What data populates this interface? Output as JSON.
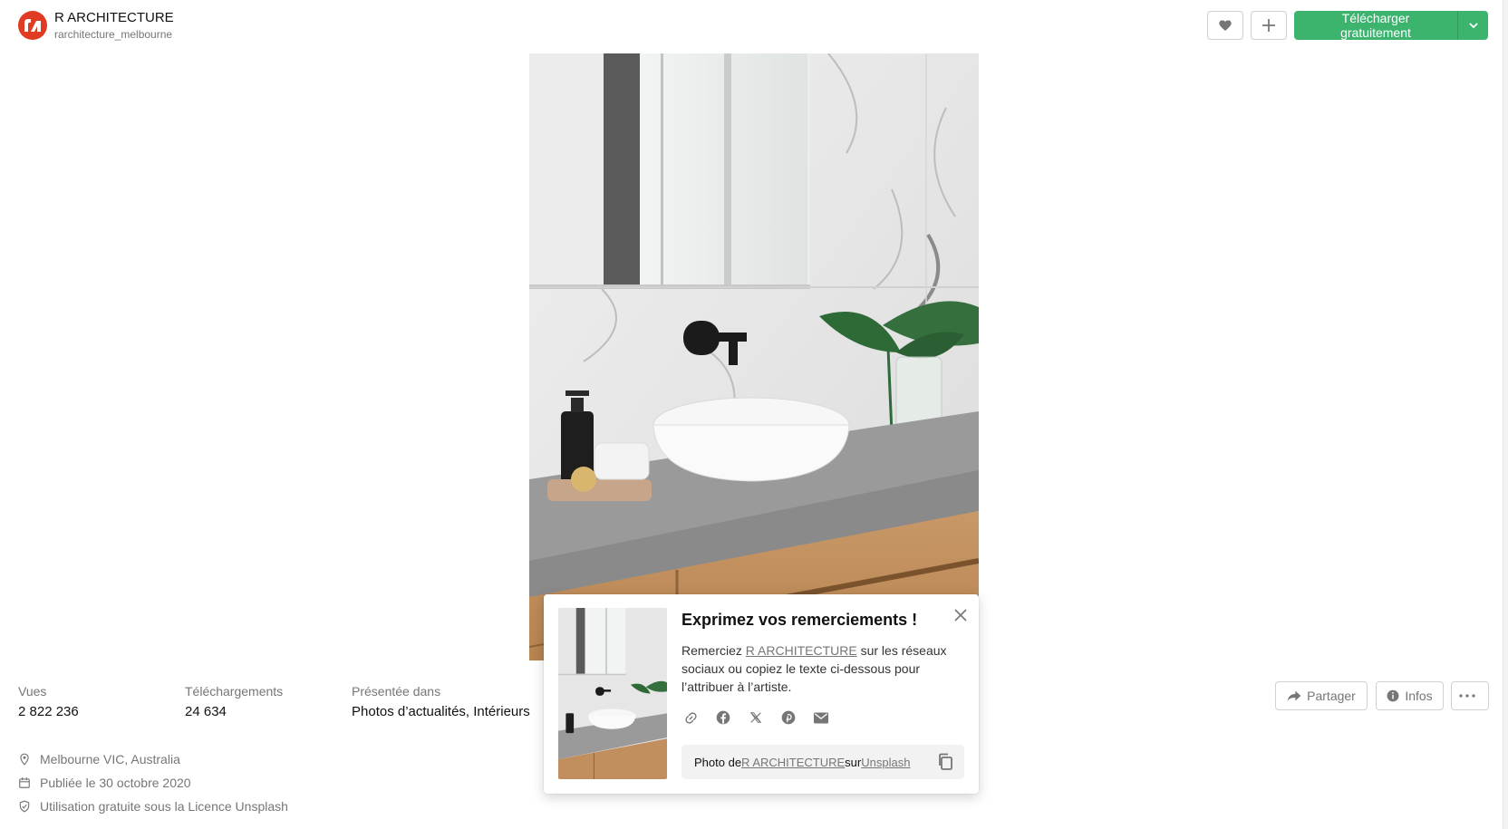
{
  "author": {
    "name": "R ARCHITECTURE",
    "handle": "rarchitecture_melbourne",
    "avatar_icon": "r-architecture-logo-icon"
  },
  "header_actions": {
    "like_icon": "heart-icon",
    "add_icon": "plus-icon",
    "download_label": "Télécharger gratuitement",
    "download_caret_icon": "chevron-down-icon",
    "accent_color": "#3cb46e"
  },
  "photo": {
    "subject_icon": "bathroom-vanity-photo"
  },
  "stats": {
    "views_label": "Vues",
    "views_value": "2 822 236",
    "downloads_label": "Téléchargements",
    "downloads_value": "24 634",
    "featured_label": "Présentée dans",
    "featured_value": "Photos d’actualités, Intérieurs"
  },
  "meta": {
    "location": "Melbourne VIC, Australia",
    "published": "Publiée le 30 octobre 2020",
    "license": "Utilisation gratuite sous la Licence Unsplash"
  },
  "actions": {
    "share_label": "Partager",
    "info_label": "Infos",
    "more_icon": "ellipsis-icon"
  },
  "popup": {
    "title": "Exprimez vos remerciements !",
    "body_prefix": "Remerciez ",
    "body_author": "R ARCHITECTURE",
    "body_suffix": " sur les réseaux sociaux ou copiez le texte ci-dessous pour l’attribuer à l’artiste.",
    "attrib_prefix": "Photo de ",
    "attrib_author": "R ARCHITECTURE",
    "attrib_mid": " sur ",
    "attrib_site": "Unsplash"
  }
}
